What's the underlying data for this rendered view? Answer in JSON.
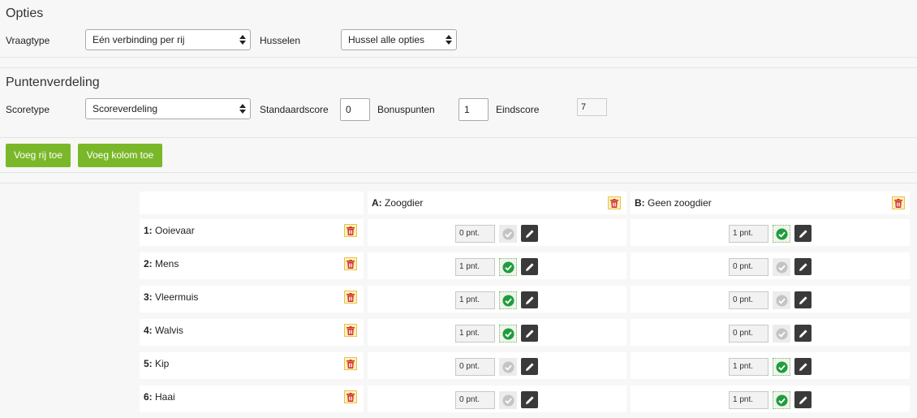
{
  "options": {
    "title": "Opties",
    "question_type_label": "Vraagtype",
    "question_type_value": "Eén verbinding per rij",
    "shuffle_label": "Husselen",
    "shuffle_value": "Hussel alle opties"
  },
  "scoring": {
    "title": "Puntenverdeling",
    "score_type_label": "Scoretype",
    "score_type_value": "Scoreverdeling",
    "default_score_label": "Standaardscore",
    "default_score_value": "0",
    "bonus_label": "Bonuspunten",
    "bonus_value": "1",
    "final_score_label": "Eindscore",
    "final_score_value": "7"
  },
  "toolbar": {
    "add_row_label": "Voeg rij toe",
    "add_column_label": "Voeg kolom toe"
  },
  "colors": {
    "accent_green": "#7ab82a",
    "check_green": "#1e9e3a",
    "trash_red": "#d32f2f"
  },
  "columns": [
    {
      "key": "A:",
      "label": "Zoogdier"
    },
    {
      "key": "B:",
      "label": "Geen zoogdier"
    }
  ],
  "rows": [
    {
      "num": "1:",
      "label": "Ooievaar",
      "cells": [
        {
          "points": "0 pnt.",
          "checked": false
        },
        {
          "points": "1 pnt.",
          "checked": true
        }
      ]
    },
    {
      "num": "2:",
      "label": "Mens",
      "cells": [
        {
          "points": "1 pnt.",
          "checked": true
        },
        {
          "points": "0 pnt.",
          "checked": false
        }
      ]
    },
    {
      "num": "3:",
      "label": "Vleermuis",
      "cells": [
        {
          "points": "1 pnt.",
          "checked": true
        },
        {
          "points": "0 pnt.",
          "checked": false
        }
      ]
    },
    {
      "num": "4:",
      "label": "Walvis",
      "cells": [
        {
          "points": "1 pnt.",
          "checked": true
        },
        {
          "points": "0 pnt.",
          "checked": false
        }
      ]
    },
    {
      "num": "5:",
      "label": "Kip",
      "cells": [
        {
          "points": "0 pnt.",
          "checked": false
        },
        {
          "points": "1 pnt.",
          "checked": true
        }
      ]
    },
    {
      "num": "6:",
      "label": "Haai",
      "cells": [
        {
          "points": "0 pnt.",
          "checked": false
        },
        {
          "points": "1 pnt.",
          "checked": true
        }
      ]
    }
  ]
}
